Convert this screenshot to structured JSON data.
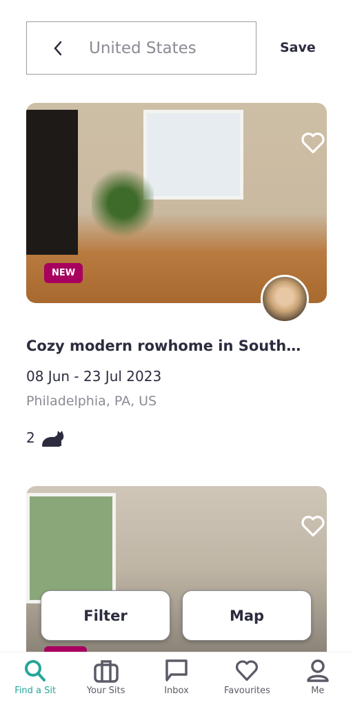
{
  "header": {
    "search_value": "United States",
    "save_label": "Save"
  },
  "listings": [
    {
      "badge": "NEW",
      "title": "Cozy modern rowhome in South…",
      "dates": "08 Jun - 23 Jul 2023",
      "location": "Philadelphia, PA, US",
      "pet_count": "2",
      "pet_icon": "cat-icon",
      "favourited": false
    },
    {
      "badge": "NEW",
      "favourited": false
    }
  ],
  "floating": {
    "filter_label": "Filter",
    "map_label": "Map"
  },
  "nav": {
    "items": [
      {
        "label": "Find a Sit",
        "icon": "search-icon",
        "active": true
      },
      {
        "label": "Your Sits",
        "icon": "briefcase-icon"
      },
      {
        "label": "Inbox",
        "icon": "chat-icon"
      },
      {
        "label": "Favourites",
        "icon": "heart-icon"
      },
      {
        "label": "Me",
        "icon": "user-icon"
      }
    ]
  },
  "colors": {
    "accent": "#26a69a",
    "badge": "#a8005e",
    "text": "#2b2c3e",
    "muted": "#8a8b94"
  }
}
